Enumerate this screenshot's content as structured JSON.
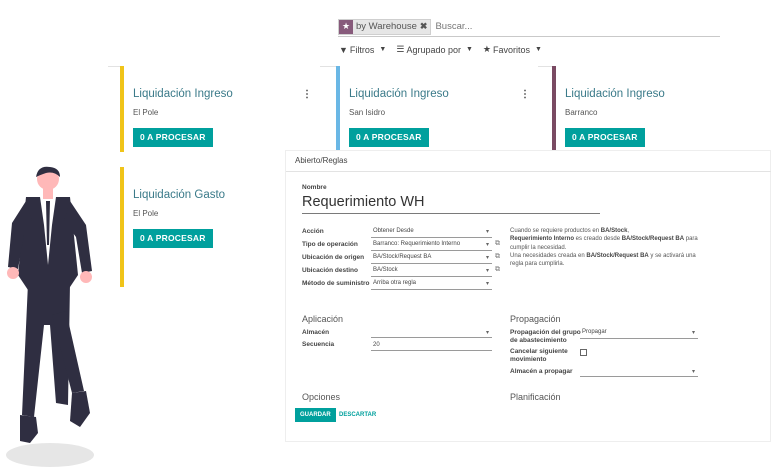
{
  "search": {
    "facet_label": "by Warehouse",
    "placeholder": "Buscar..."
  },
  "filters": {
    "filters_label": "Filtros",
    "groupby_label": "Agrupado por",
    "favorites_label": "Favoritos"
  },
  "cards": [
    {
      "title": "Liquidación Ingreso",
      "subtitle": "El Pole",
      "button": "0 A PROCESAR",
      "color": "#f0c419"
    },
    {
      "title": "Liquidación Ingreso",
      "subtitle": "San Isidro",
      "button": "0 A PROCESAR",
      "color": "#6ab7e5"
    },
    {
      "title": "Liquidación Ingreso",
      "subtitle": "Barranco",
      "button": "0 A PROCESAR",
      "color": "#7a4a63"
    },
    {
      "title": "Liquidación Gasto",
      "subtitle": "El Pole",
      "button": "0 A PROCESAR",
      "color": "#f0c419"
    }
  ],
  "form": {
    "breadcrumb": "Abierto/Reglas",
    "name_label": "Nombre",
    "name_value": "Requerimiento WH",
    "fields": [
      {
        "label": "Acción",
        "value": "Obtener Desde"
      },
      {
        "label": "Tipo de operación",
        "value": "Barranco: Requerimiento Interno"
      },
      {
        "label": "Ubicación de origen",
        "value": "BA/Stock/Request BA"
      },
      {
        "label": "Ubicación destino",
        "value": "BA/Stock"
      },
      {
        "label": "Método de suministro",
        "value": "Arriba otra regla"
      }
    ],
    "help": {
      "line1_pre": "Cuando se requiere productos en ",
      "line1_bold": "BA/Stock",
      "line1_post": ",",
      "line2_bold1": "Requerimiento Interno",
      "line2_mid": " es creado desde ",
      "line2_bold2": "BA/Stock/Request BA",
      "line2_post": " para",
      "line3": "cumplir la necesidad.",
      "line4_pre": "Una necesidades creada en ",
      "line4_bold": "BA/Stock/Request BA",
      "line4_post": " y se activará una",
      "line5": "regla para cumplirla."
    },
    "sections": {
      "aplicacion": "Aplicación",
      "propagacion": "Propagación",
      "opciones": "Opciones",
      "planificacion": "Planificación"
    },
    "aplicacion_fields": [
      {
        "label": "Almacén",
        "value": ""
      },
      {
        "label": "Secuencia",
        "value": "20"
      }
    ],
    "propagacion_fields": {
      "group_label_1": "Propagación del grupo",
      "group_label_2": "de abastecimiento",
      "group_value": "Propagar",
      "cancel_label_1": "Cancelar siguiente",
      "cancel_label_2": "movimiento",
      "warehouse_label": "Almacén a propagar"
    },
    "save_label": "GUARDAR",
    "discard_label": "DESCARTAR"
  },
  "colors": {
    "primary": "#00a09d",
    "facet": "#875a7b",
    "suit": "#2f2e41",
    "skin": "#ffb8b8"
  }
}
